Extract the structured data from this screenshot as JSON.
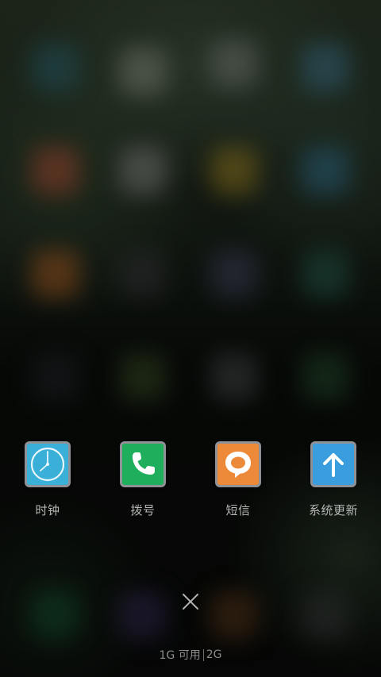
{
  "apps": [
    {
      "label": "时钟",
      "icon": "clock-icon",
      "color": "#3ab0d8"
    },
    {
      "label": "拨号",
      "icon": "phone-icon",
      "color": "#1fae5c"
    },
    {
      "label": "短信",
      "icon": "message-icon",
      "color": "#ec8a3a"
    },
    {
      "label": "系统更新",
      "icon": "arrow-up-icon",
      "color": "#3a9ede"
    }
  ],
  "close": {
    "icon": "close-icon"
  },
  "memory": {
    "available": "1G 可用",
    "total": "2G"
  }
}
